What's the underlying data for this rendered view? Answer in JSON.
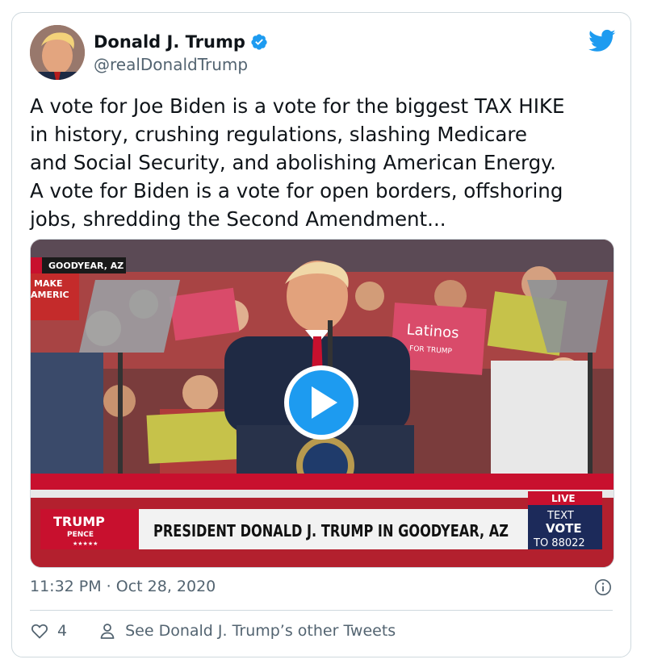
{
  "tweet": {
    "author_name": "Donald J. Trump",
    "author_handle": "@realDonaldTrump",
    "body": "A vote for Joe Biden is a vote for the biggest TAX HIKE\nin history, crushing regulations, slashing Medicare\nand Social Security, and abolishing American Energy.\nA vote for Biden is a vote for open borders, offshoring\njobs, shredding the Second Amendment...",
    "timestamp": "11:32 PM · Oct 28, 2020",
    "like_count": "4",
    "other_tweets_label": "See Donald J. Trump’s other Tweets"
  },
  "video": {
    "location_tag": "GOODYEAR, AZ",
    "live_badge": "LIVE",
    "chyron_logo_line1": "TRUMP",
    "chyron_logo_line2": "PENCE",
    "chyron_logo_stars": "★★★★★",
    "chyron_headline": "PRESIDENT DONALD J. TRUMP IN GOODYEAR, AZ",
    "text_vote_line1": "TEXT",
    "text_vote_line2": "VOTE",
    "text_vote_line3": "TO 88022",
    "sign_text_1": "Latinos",
    "sign_text_2": "FOR TRUMP",
    "sign_text_3": "MAKE",
    "sign_text_4": "AMERIC"
  },
  "colors": {
    "twitter_blue": "#1d9bf0",
    "text_primary": "#0f1419",
    "text_secondary": "#536471",
    "chyron_red": "#c8102e",
    "chyron_navy": "#1c2a5a"
  },
  "icons": [
    "verified-badge-icon",
    "twitter-bird-icon",
    "play-icon",
    "info-icon",
    "heart-icon",
    "person-icon"
  ]
}
